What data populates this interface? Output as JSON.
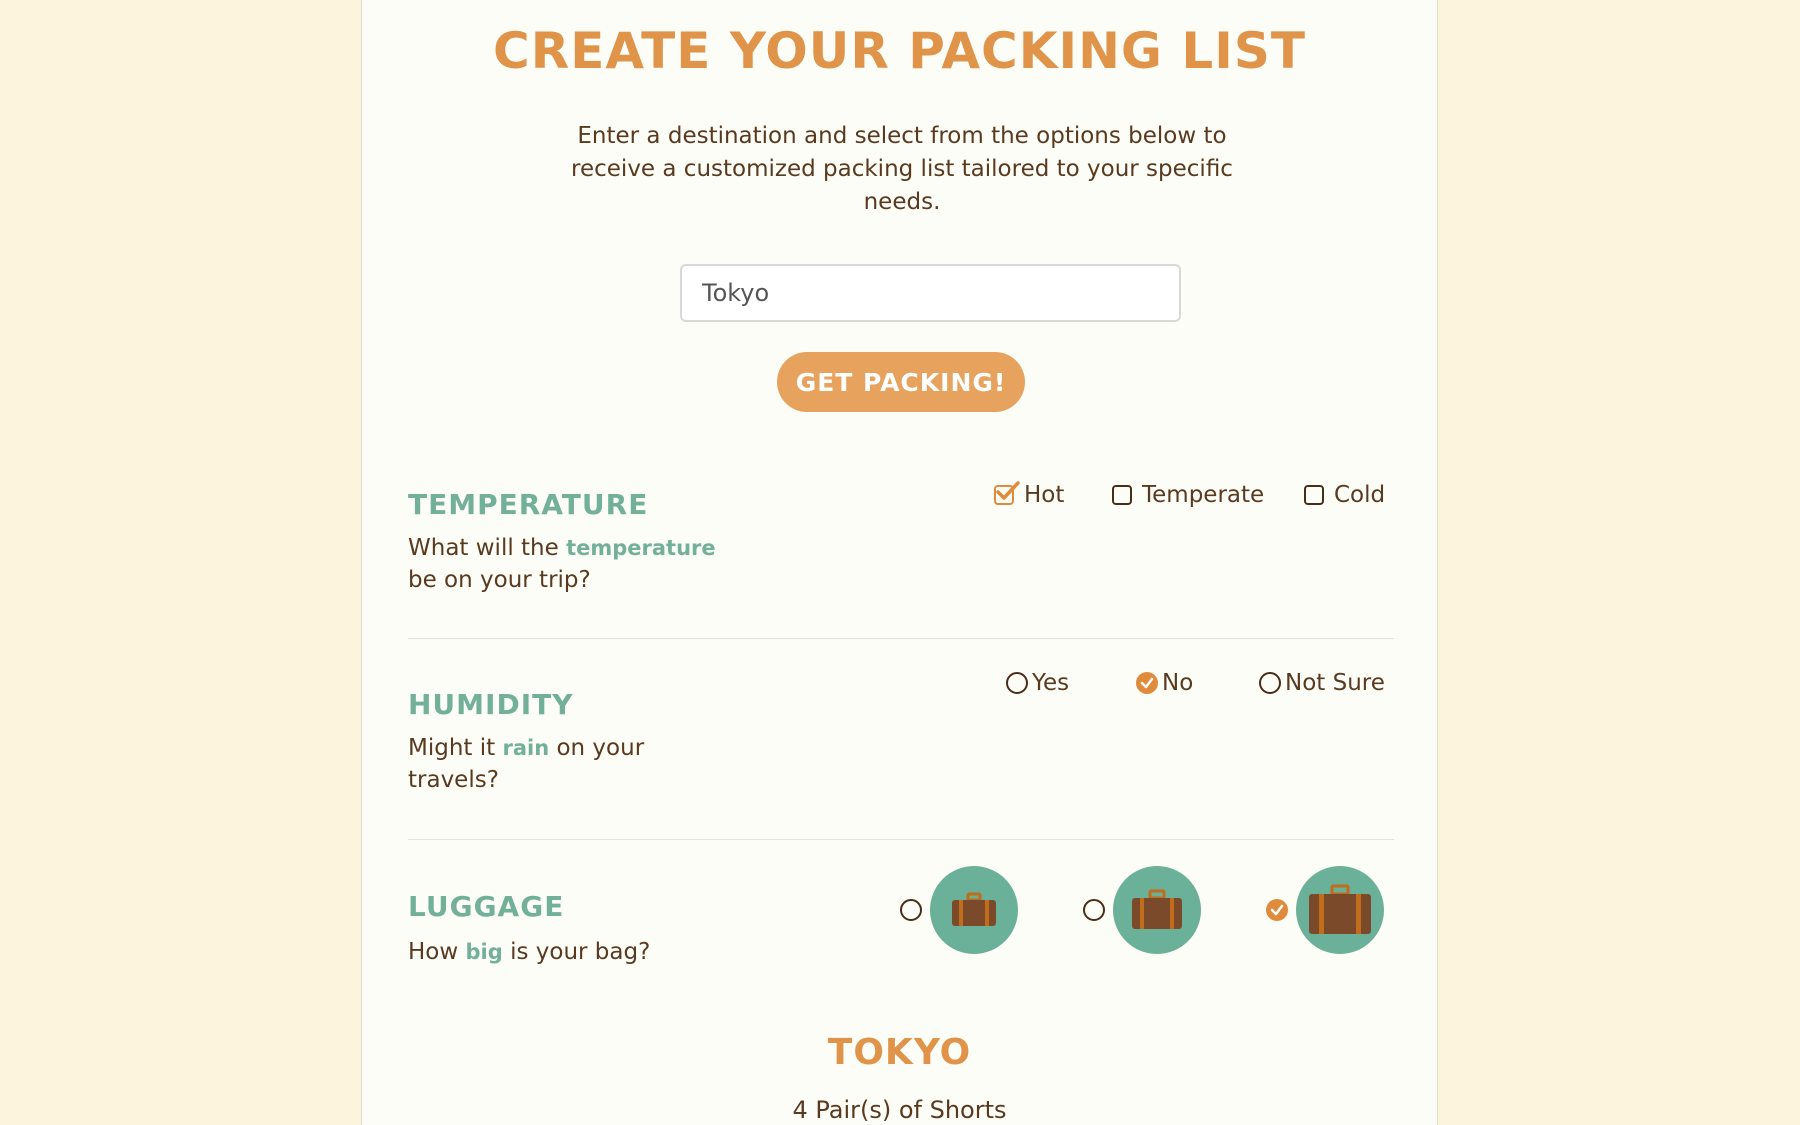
{
  "header": {
    "title": "CREATE YOUR PACKING LIST",
    "intro": "Enter a destination and select from the options below to receive a customized packing list tailored to your specific needs."
  },
  "search": {
    "value": "Tokyo",
    "button_label": "GET PACKING!"
  },
  "temperature": {
    "title": "TEMPERATURE",
    "question_pre": "What will the ",
    "question_highlight": "temperature",
    "question_post": " be on your trip?",
    "options": [
      {
        "label": "Hot",
        "checked": true
      },
      {
        "label": "Temperate",
        "checked": false
      },
      {
        "label": "Cold",
        "checked": false
      }
    ]
  },
  "humidity": {
    "title": "HUMIDITY",
    "question_pre": "Might it ",
    "question_highlight": "rain",
    "question_post": " on your travels?",
    "options": [
      {
        "label": "Yes",
        "selected": false
      },
      {
        "label": "No",
        "selected": true
      },
      {
        "label": "Not Sure",
        "selected": false
      }
    ]
  },
  "luggage": {
    "title": "LUGGAGE",
    "question_pre": "How ",
    "question_highlight": "big",
    "question_post": " is your bag?",
    "options": [
      {
        "size": "small",
        "icon": "suitcase-small-icon",
        "selected": false
      },
      {
        "size": "medium",
        "icon": "suitcase-medium-icon",
        "selected": false
      },
      {
        "size": "large",
        "icon": "suitcase-large-icon",
        "selected": true
      }
    ]
  },
  "result": {
    "city": "TOKYO",
    "items": [
      "4 Pair(s) of Shorts"
    ]
  },
  "colors": {
    "accent": "#e0944a",
    "button": "#e7a25e",
    "teal": "#72b09a",
    "text": "#5a3a1f",
    "page_bg": "#fcf4dc"
  }
}
